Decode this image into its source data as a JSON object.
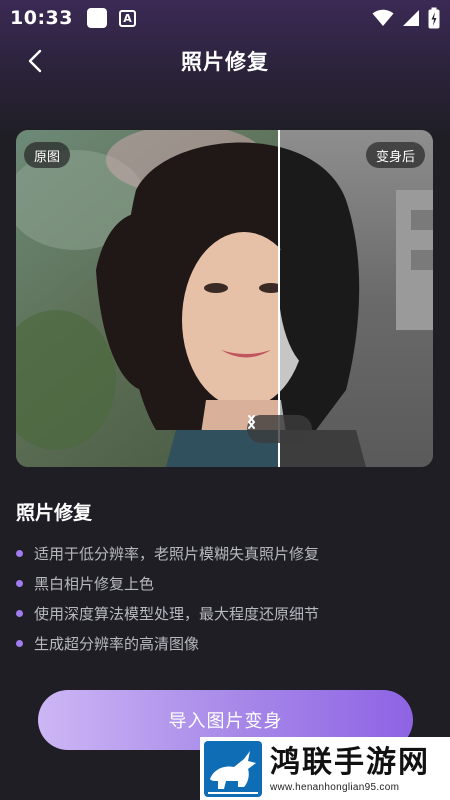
{
  "status_bar": {
    "time": "10:33",
    "a_icon_glyph": "A"
  },
  "nav": {
    "title": "照片修复"
  },
  "compare": {
    "left_label": "原图",
    "right_label": "变身后"
  },
  "section": {
    "title": "照片修复"
  },
  "features": [
    "适用于低分辨率，老照片模糊失真照片修复",
    "黑白相片修复上色",
    "使用深度算法模型处理，最大程度还原细节",
    "生成超分辨率的高清图像"
  ],
  "cta": {
    "label": "导入图片变身"
  },
  "watermark": {
    "brand": "鸿联手游网",
    "url": "www.henanhonglian95.com"
  },
  "colors": {
    "accent": "#8e63e4",
    "bullet": "#a07cf0",
    "background": "#1e1e24"
  }
}
